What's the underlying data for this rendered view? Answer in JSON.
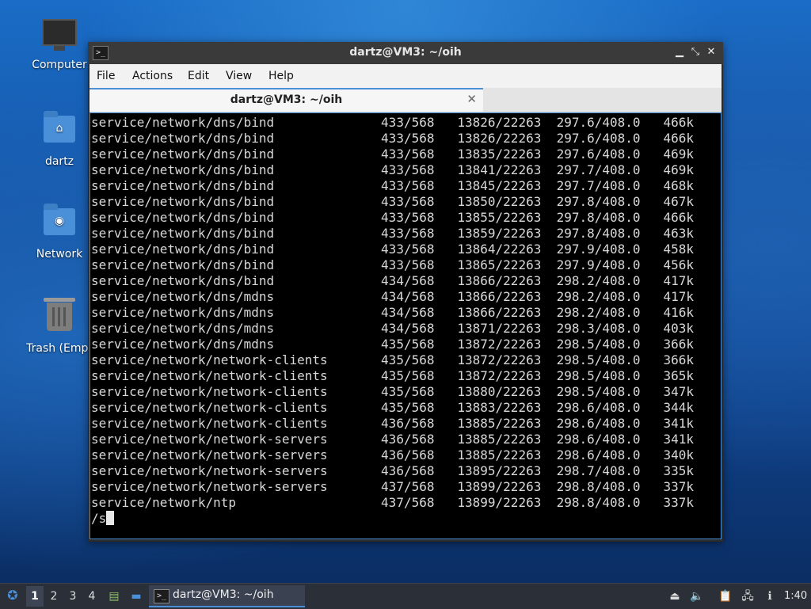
{
  "desktop": {
    "icons": [
      {
        "label": "Computer"
      },
      {
        "label": "dartz"
      },
      {
        "label": "Network"
      },
      {
        "label": "Trash (Empt"
      }
    ]
  },
  "window": {
    "title": "dartz@VM3: ~/oih",
    "buttons": {
      "minimize": "▁",
      "maximize": "⤡",
      "close": "✕"
    },
    "menu": [
      "File",
      "Actions",
      "Edit",
      "View",
      "Help"
    ],
    "tab": {
      "label": "dartz@VM3: ~/oih",
      "close": "✕"
    }
  },
  "terminal": {
    "lines": [
      "service/network/dns/bind              433/568   13826/22263  297.6/408.0   466k",
      "service/network/dns/bind              433/568   13826/22263  297.6/408.0   466k",
      "service/network/dns/bind              433/568   13835/22263  297.6/408.0   469k",
      "service/network/dns/bind              433/568   13841/22263  297.7/408.0   469k",
      "service/network/dns/bind              433/568   13845/22263  297.7/408.0   468k",
      "service/network/dns/bind              433/568   13850/22263  297.8/408.0   467k",
      "service/network/dns/bind              433/568   13855/22263  297.8/408.0   466k",
      "service/network/dns/bind              433/568   13859/22263  297.8/408.0   463k",
      "service/network/dns/bind              433/568   13864/22263  297.9/408.0   458k",
      "service/network/dns/bind              433/568   13865/22263  297.9/408.0   456k",
      "service/network/dns/bind              434/568   13866/22263  298.2/408.0   417k",
      "service/network/dns/mdns              434/568   13866/22263  298.2/408.0   417k",
      "service/network/dns/mdns              434/568   13866/22263  298.2/408.0   416k",
      "service/network/dns/mdns              434/568   13871/22263  298.3/408.0   403k",
      "service/network/dns/mdns              435/568   13872/22263  298.5/408.0   366k",
      "service/network/network-clients       435/568   13872/22263  298.5/408.0   366k",
      "service/network/network-clients       435/568   13872/22263  298.5/408.0   365k",
      "service/network/network-clients       435/568   13880/22263  298.5/408.0   347k",
      "service/network/network-clients       435/568   13883/22263  298.6/408.0   344k",
      "service/network/network-clients       436/568   13885/22263  298.6/408.0   341k",
      "service/network/network-servers       436/568   13885/22263  298.6/408.0   341k",
      "service/network/network-servers       436/568   13885/22263  298.6/408.0   340k",
      "service/network/network-servers       436/568   13895/22263  298.7/408.0   335k",
      "service/network/network-servers       437/568   13899/22263  298.8/408.0   337k",
      "service/network/ntp                   437/568   13899/22263  298.8/408.0   337k"
    ],
    "prompt": "/s"
  },
  "taskbar": {
    "workspaces": [
      "1",
      "2",
      "3",
      "4"
    ],
    "active_workspace": "1",
    "task": {
      "label": "dartz@VM3: ~/oih"
    },
    "clock": "1:40"
  },
  "colors": {
    "accent": "#4a90d9",
    "terminal_bg": "#000000",
    "terminal_fg": "#d8d8d8",
    "titlebar": "#3a3a3a",
    "taskbar": "#2a2f38"
  }
}
